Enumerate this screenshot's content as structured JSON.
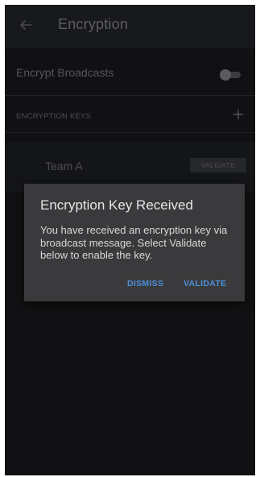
{
  "appbar": {
    "back_icon": "arrow-left-icon",
    "title": "Encryption"
  },
  "settings": {
    "encrypt_broadcasts_label": "Encrypt Broadcasts",
    "encrypt_broadcasts_enabled": false
  },
  "keys_section": {
    "header": "ENCRYPTION KEYS",
    "add_icon": "plus-icon",
    "items": [
      {
        "name": "Team A",
        "action_label": "VALIDATE"
      }
    ]
  },
  "dialog": {
    "title": "Encryption Key Received",
    "body": "You have received an encryption key via broadcast message. Select Validate below to enable the key.",
    "dismiss_label": "DISMISS",
    "validate_label": "VALIDATE"
  },
  "colors": {
    "background": "#111113",
    "dialog_bg": "#3a3a3c",
    "accent": "#4d8fd9"
  }
}
